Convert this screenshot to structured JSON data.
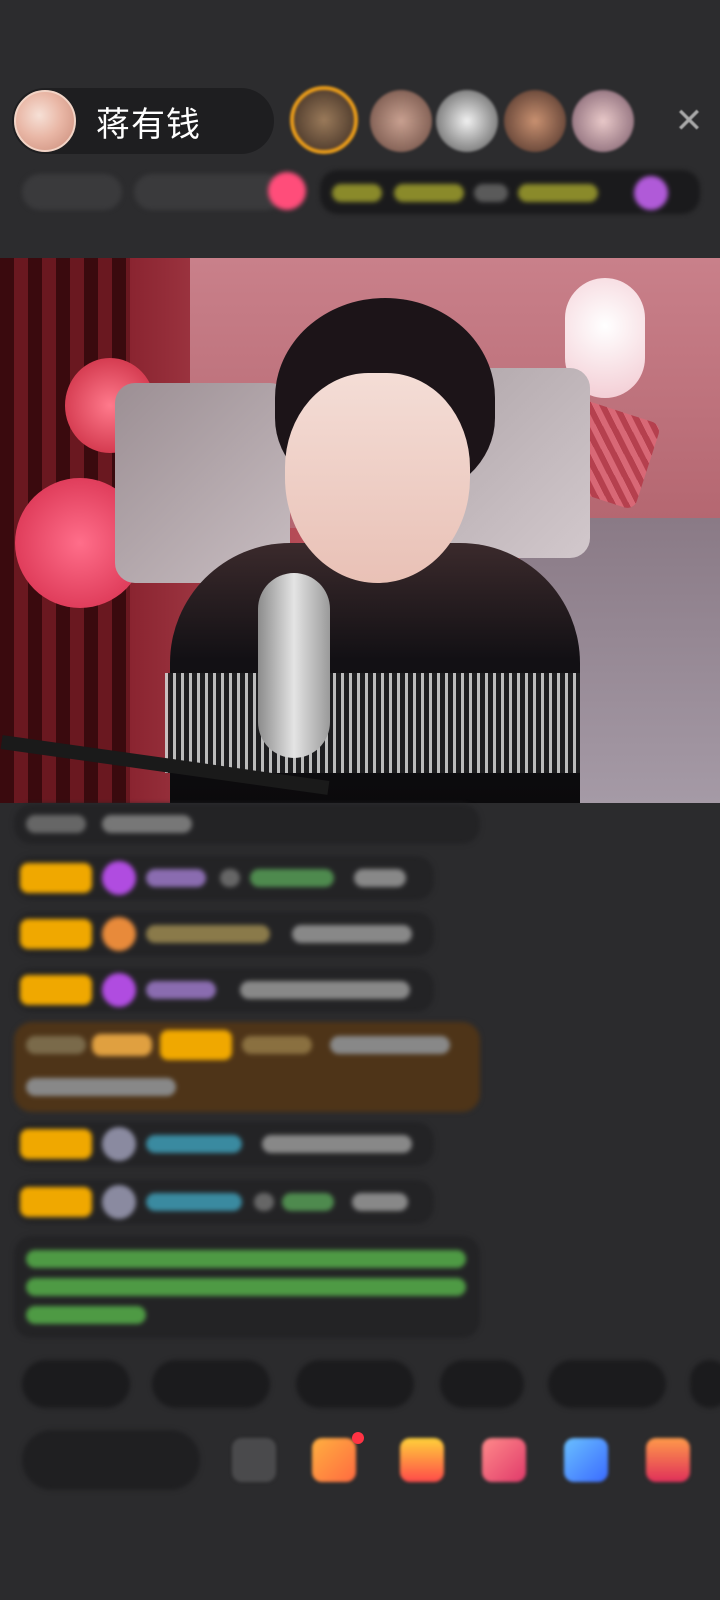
{
  "host": {
    "name": "蒋有钱"
  },
  "colors": {
    "background": "#2b2b2d",
    "pill": "#1e1e20",
    "level_badge": "#f0a800",
    "highlight_comment": "#5c3c14",
    "system_text_green": "#6fcf63"
  },
  "icons": {
    "close": "close-icon",
    "viewer_avatars": "avatar",
    "gift": "gift-icon",
    "more": "more-icon"
  },
  "close_glyph": "✕"
}
